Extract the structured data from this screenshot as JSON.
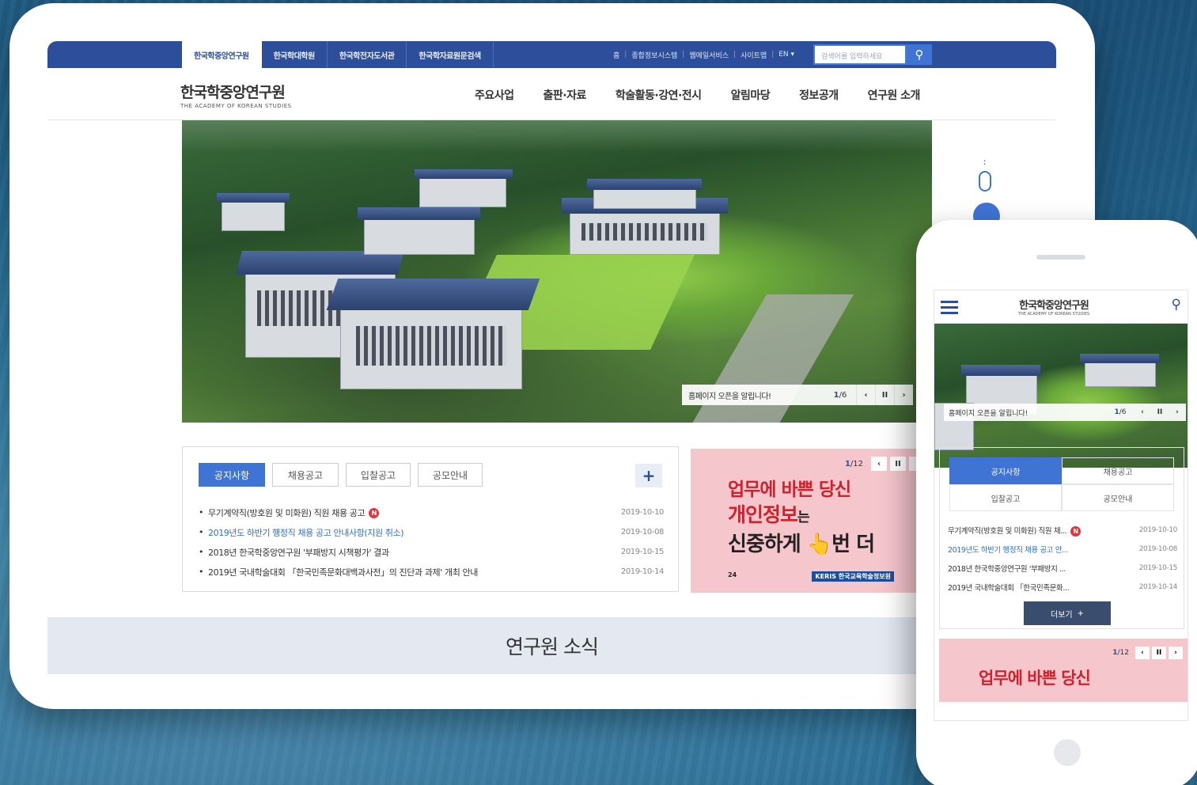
{
  "tablet": {
    "topbar": {
      "tabs": [
        "한국학중앙연구원",
        "한국학대학원",
        "한국학전자도서관",
        "한국학자료원문검색"
      ],
      "util": [
        "홈",
        "종합정보시스템",
        "웹메일서비스",
        "사이트맵",
        "EN ▾"
      ],
      "search_placeholder": "검색어를 입력하세요"
    },
    "logo": {
      "ko": "한국학중앙연구원",
      "en": "THE ACADEMY OF KOREAN STUDIES"
    },
    "menu": [
      "주요사업",
      "출판·자료",
      "학술활동·강연·전시",
      "알림마당",
      "정보공개",
      "연구원 소개"
    ],
    "hero": {
      "caption": "홈페이지 오픈을 알립니다!",
      "page_current": "1",
      "page_total": "/6"
    },
    "notice": {
      "tabs": [
        "공지사항",
        "채용공고",
        "입찰공고",
        "공모안내"
      ],
      "more": "+",
      "items": [
        {
          "title": "무기계약직(방호원 및 미화원) 직원 채용 공고",
          "date": "2019-10-10",
          "new": "N"
        },
        {
          "title": "2019년도 하반기 행정직 채용 공고 안내사항(지원 취소)",
          "date": "2019-10-08"
        },
        {
          "title": "2018년 한국학중앙연구원 '부패방지 시책평가' 결과",
          "date": "2019-10-15"
        },
        {
          "title": "2019년 국내학술대회 「한국민족문화대백과사전」의 진단과 과제' 개최 안내",
          "date": "2019-10-14"
        }
      ]
    },
    "promo": {
      "page_current": "1",
      "page_total": "/12",
      "line1": "업무에 바쁜 당신",
      "line2": "개인정보",
      "line2_suffix": "는",
      "line3": "신중하게 👆번 더",
      "logo_left": "24",
      "logo_right": "KERIS 한국교육학술정보원"
    },
    "news_title": "연구원 소식"
  },
  "phone": {
    "logo": {
      "ko": "한국학중앙연구원",
      "en": "THE ACADEMY OF KOREAN STUDIES"
    },
    "hero": {
      "caption": "홈페이지 오픈을 알립니다!",
      "page_current": "1",
      "page_total": "/6"
    },
    "tabs": [
      "공지사항",
      "채용공고",
      "입찰공고",
      "공모안내"
    ],
    "items": [
      {
        "title": "무기계약직(방호원 및 미화원) 직원 채...",
        "date": "2019-10-10",
        "new": "N"
      },
      {
        "title": "2019년도 하반기 행정직 채용 공고 안...",
        "date": "2019-10-08"
      },
      {
        "title": "2018년 한국학중앙연구원 '부패방지 ...",
        "date": "2019-10-15"
      },
      {
        "title": "2019년 국내학술대회 「한국민족문화...",
        "date": "2019-10-14"
      }
    ],
    "more_label": "더보기",
    "more_icon": "+",
    "promo": {
      "page_current": "1",
      "page_total": "/12",
      "line1": "업무에 바쁜 당신"
    }
  },
  "icons": {
    "search": "🔍",
    "prev": "‹",
    "pause": "II",
    "next": "›"
  },
  "colors": {
    "brand_blue": "#2d4e9a",
    "accent_blue": "#3f73d4",
    "alert_red": "#d3202c",
    "promo_pink": "#f5c6cc"
  }
}
